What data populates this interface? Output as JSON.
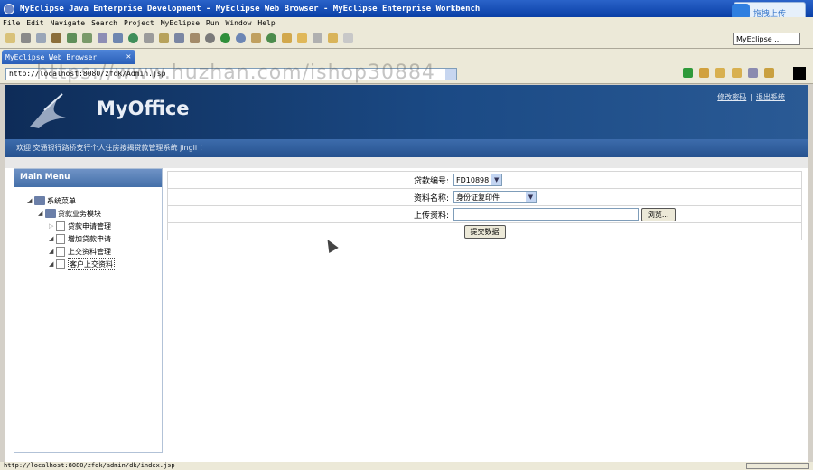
{
  "window": {
    "title": "MyEclipse Java Enterprise Development - MyEclipse Web Browser - MyEclipse Enterprise Workbench"
  },
  "cloud_button": {
    "label": "拖拽上传"
  },
  "menu": [
    "File",
    "Edit",
    "Navigate",
    "Search",
    "Project",
    "MyEclipse",
    "Run",
    "Window",
    "Help"
  ],
  "perspective": {
    "label": "MyEclipse ..."
  },
  "tab": {
    "label": "MyEclipse Web Browser",
    "close": "✕"
  },
  "address": {
    "url": "http://localhost:8080/zfdk/Admin.jsp"
  },
  "watermark": {
    "text": "https://www.huzhan.com/ishop30884"
  },
  "app": {
    "logo": "MyOffice",
    "links": {
      "change_password": "修改密码",
      "separator": "|",
      "logout": "退出系统"
    },
    "welcome": "欢迎 交通银行路桥支行个人住房按揭贷款管理系统 jingli ！"
  },
  "sidebar": {
    "title": "Main Menu",
    "root": "系统菜单",
    "module": "贷款业务模块",
    "items": [
      "贷款申请管理",
      "增加贷款申请",
      "上交资料管理",
      "客户上交资料"
    ]
  },
  "form": {
    "loan_no_label": "贷款编号:",
    "loan_no_value": "FD10898",
    "doc_name_label": "资料名称:",
    "doc_name_value": "身份证复印件",
    "upload_label": "上传资料:",
    "browse_label": "浏览...",
    "submit_label": "提交数据"
  },
  "status": {
    "text": "http://localhost:8080/zfdk/admin/dk/index.jsp"
  }
}
